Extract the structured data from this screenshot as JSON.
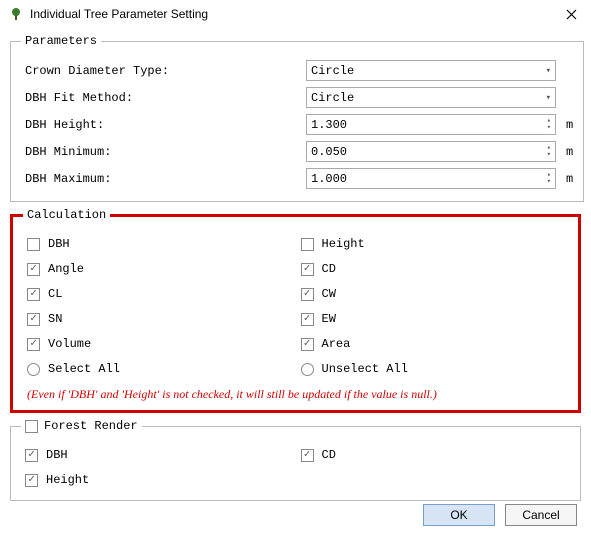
{
  "window": {
    "title": "Individual Tree Parameter Setting"
  },
  "parameters": {
    "legend": "Parameters",
    "crown_diameter_type_label": "Crown Diameter Type:",
    "crown_diameter_type_value": "Circle",
    "dbh_fit_method_label": "DBH Fit Method:",
    "dbh_fit_method_value": "Circle",
    "dbh_height_label": "DBH Height:",
    "dbh_height_value": "1.300",
    "dbh_minimum_label": "DBH Minimum:",
    "dbh_minimum_value": "0.050",
    "dbh_maximum_label": "DBH Maximum:",
    "dbh_maximum_value": "1.000",
    "unit_m": "m"
  },
  "calculation": {
    "legend": "Calculation",
    "items": [
      {
        "label": "DBH",
        "checked": false
      },
      {
        "label": "Height",
        "checked": false
      },
      {
        "label": "Angle",
        "checked": true
      },
      {
        "label": "CD",
        "checked": true
      },
      {
        "label": "CL",
        "checked": true
      },
      {
        "label": "CW",
        "checked": true
      },
      {
        "label": "SN",
        "checked": true
      },
      {
        "label": "EW",
        "checked": true
      },
      {
        "label": "Volume",
        "checked": true
      },
      {
        "label": "Area",
        "checked": true
      }
    ],
    "select_all_label": "Select All",
    "unselect_all_label": "Unselect All",
    "note": "(Even if 'DBH' and 'Height' is not checked, it will still be updated if the value is null.)"
  },
  "forest_render": {
    "legend": "Forest Render",
    "legend_checked": false,
    "items": [
      {
        "label": "DBH",
        "checked": true
      },
      {
        "label": "CD",
        "checked": true
      },
      {
        "label": "Height",
        "checked": true
      }
    ]
  },
  "buttons": {
    "ok": "OK",
    "cancel": "Cancel"
  }
}
